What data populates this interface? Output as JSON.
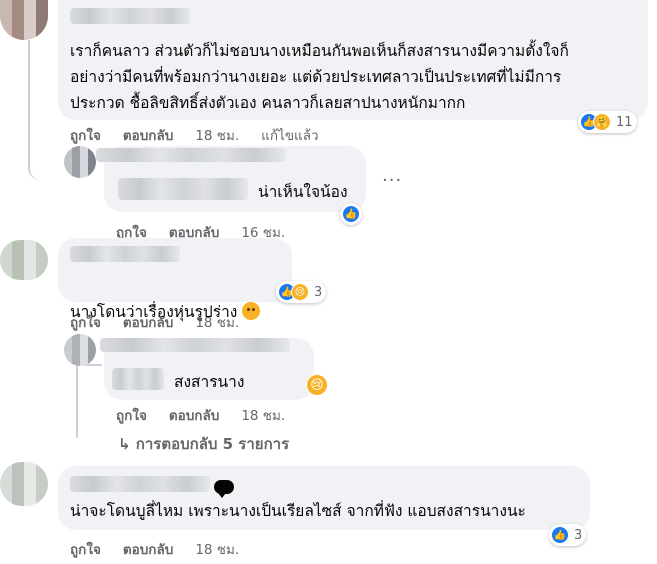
{
  "comments": [
    {
      "text": "เราก็คนลาว ส่วนตัวก็ไม่ชอบนางเหมือนกันพอเห็นก็สงสารนางมีความตั้งใจก็\nอย่างว่ามีคนที่พร้อมกว่านางเยอะ แต่ด้วยประเทศลาวเป็นประเทศที่ไม่มีการ\nประกวด ชื้อลิขสิทธิ์ส่งตัวเอง คนลาวก็เลยสาปนางหนักมากก",
      "like": "ถูกใจ",
      "reply": "ตอบกลับ",
      "time": "18 ชม.",
      "edited": "แก้ไขแล้ว",
      "reaction_count": "11"
    },
    {
      "text": "น่าเห็นใจน้อง",
      "like": "ถูกใจ",
      "reply": "ตอบกลับ",
      "time": "16 ชม.",
      "more": "···"
    },
    {
      "text": "นางโดนว่าเรื่องหุ่นรูปร่าง",
      "like": "ถูกใจ",
      "reply": "ตอบกลับ",
      "time": "18 ชม.",
      "reaction_count": "3"
    },
    {
      "text": "สงสารนาง",
      "like": "ถูกใจ",
      "reply": "ตอบกลับ",
      "time": "18 ชม."
    },
    {
      "text": "น่าจะโดนบูลี่ไหม เพราะนางเป็นเรียลไซส์ จากที่ฟัง แอบสงสารนางนะ",
      "like": "ถูกใจ",
      "reply": "ตอบกลับ",
      "time": "18 ชม.",
      "reaction_count": "3"
    }
  ],
  "replies_link": "↳ การตอบกลับ 5 รายการ",
  "icons": {
    "like": "like-icon",
    "care": "care-icon",
    "sad": "sad-icon",
    "speech": "speech-bubble-icon"
  },
  "colors": {
    "bubble": "#f0f2f5",
    "meta": "#65676b",
    "like": "#1877f2",
    "emoji": "#f7b125"
  }
}
